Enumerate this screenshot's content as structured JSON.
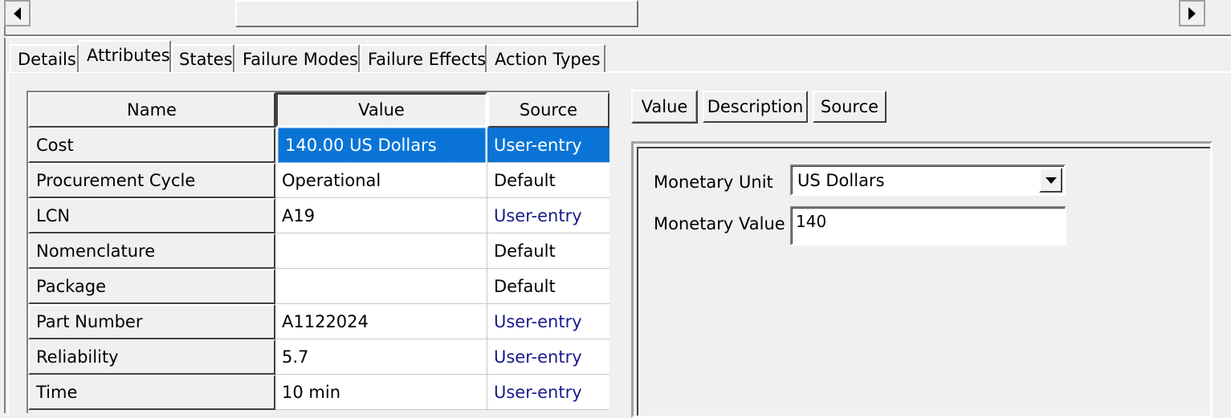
{
  "main_tabs": [
    {
      "label": "Details"
    },
    {
      "label": "Attributes"
    },
    {
      "label": "States"
    },
    {
      "label": "Failure Modes"
    },
    {
      "label": "Failure Effects"
    },
    {
      "label": "Action Types"
    }
  ],
  "active_tab": "Attributes",
  "grid": {
    "headers": {
      "name": "Name",
      "value": "Value",
      "source": "Source"
    },
    "rows": [
      {
        "name": "Cost",
        "value": "140.00 US Dollars",
        "source": "User-entry"
      },
      {
        "name": "Procurement Cycle",
        "value": "Operational",
        "source": "Default"
      },
      {
        "name": "LCN",
        "value": "A19",
        "source": "User-entry"
      },
      {
        "name": "Nomenclature",
        "value": "",
        "source": "Default"
      },
      {
        "name": "Package",
        "value": "",
        "source": "Default"
      },
      {
        "name": "Part Number",
        "value": "A1122024",
        "source": "User-entry"
      },
      {
        "name": "Reliability",
        "value": "5.7",
        "source": "User-entry"
      },
      {
        "name": "Time",
        "value": "10 min",
        "source": "User-entry"
      }
    ],
    "selected_row": "Cost"
  },
  "detail_tabs": [
    {
      "label": "Value"
    },
    {
      "label": "Description"
    },
    {
      "label": "Source"
    }
  ],
  "active_detail_tab": "Value",
  "detail": {
    "monetary_unit_label": "Monetary Unit",
    "monetary_unit_value": "US Dollars",
    "monetary_value_label": "Monetary Value",
    "monetary_value_value": "140"
  },
  "colors": {
    "selection": "#0a74d6",
    "user_entry_text": "#1a1a8c",
    "background": "#f0f0f0"
  }
}
